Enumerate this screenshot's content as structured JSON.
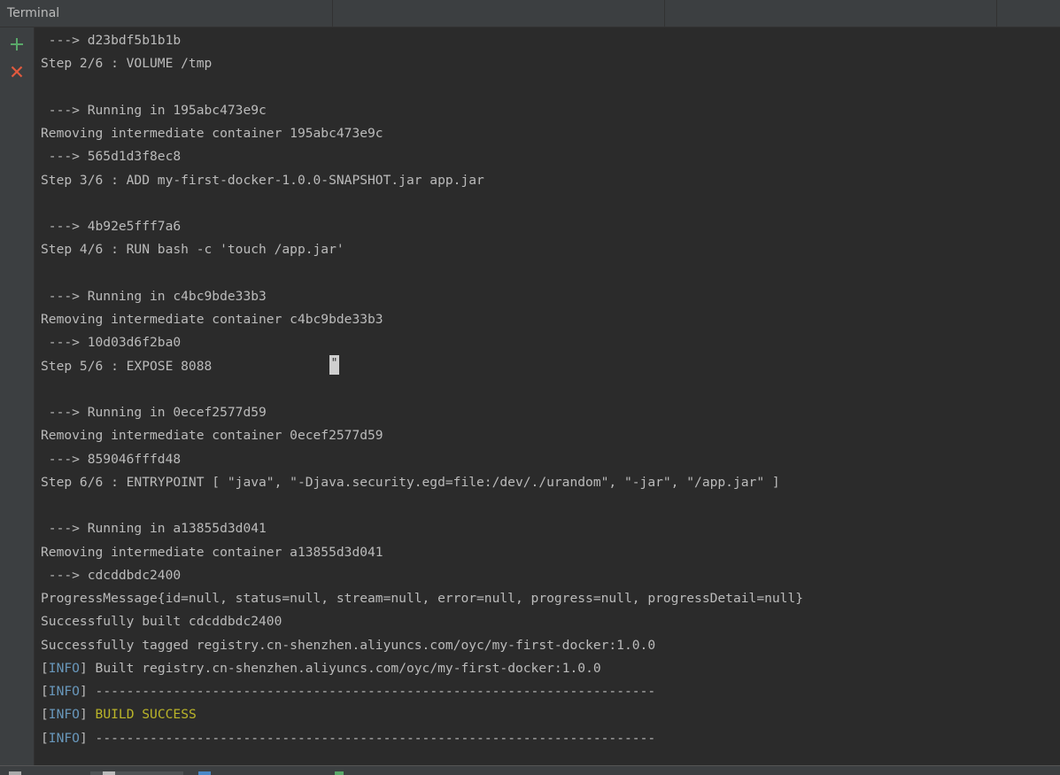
{
  "window": {
    "title": "Terminal"
  },
  "toolbar": {
    "new_icon": "plus-icon",
    "close_icon": "close-icon",
    "new_color": "#59a869",
    "close_color": "#e05a3e"
  },
  "colors": {
    "background": "#2b2b2b",
    "text": "#bbbbbb",
    "info_tag": "#6897bb",
    "success": "#bbb529"
  },
  "console": {
    "cursor_glyph": "\"",
    "lines": [
      {
        "text": " ---> d23bdf5b1b1b"
      },
      {
        "text": "Step 2/6 : VOLUME /tmp"
      },
      {
        "text": ""
      },
      {
        "text": " ---> Running in 195abc473e9c"
      },
      {
        "text": "Removing intermediate container 195abc473e9c"
      },
      {
        "text": " ---> 565d1d3f8ec8"
      },
      {
        "text": "Step 3/6 : ADD my-first-docker-1.0.0-SNAPSHOT.jar app.jar"
      },
      {
        "text": ""
      },
      {
        "text": " ---> 4b92e5fff7a6"
      },
      {
        "text": "Step 4/6 : RUN bash -c 'touch /app.jar'"
      },
      {
        "text": ""
      },
      {
        "text": " ---> Running in c4bc9bde33b3"
      },
      {
        "text": "Removing intermediate container c4bc9bde33b3"
      },
      {
        "text": " ---> 10d03d6f2ba0"
      },
      {
        "text": "Step 5/6 : EXPOSE 8088"
      },
      {
        "text": ""
      },
      {
        "text": " ---> Running in 0ecef2577d59"
      },
      {
        "text": "Removing intermediate container 0ecef2577d59"
      },
      {
        "text": " ---> 859046fffd48"
      },
      {
        "text": "Step 6/6 : ENTRYPOINT [ \"java\", \"-Djava.security.egd=file:/dev/./urandom\", \"-jar\", \"/app.jar\" ]"
      },
      {
        "text": ""
      },
      {
        "text": " ---> Running in a13855d3d041"
      },
      {
        "text": "Removing intermediate container a13855d3d041"
      },
      {
        "text": " ---> cdcddbdc2400"
      },
      {
        "text": "ProgressMessage{id=null, status=null, stream=null, error=null, progress=null, progressDetail=null}"
      },
      {
        "text": "Successfully built cdcddbdc2400"
      },
      {
        "text": "Successfully tagged registry.cn-shenzhen.aliyuncs.com/oyc/my-first-docker:1.0.0"
      },
      {
        "tag": "INFO",
        "text": " Built registry.cn-shenzhen.aliyuncs.com/oyc/my-first-docker:1.0.0"
      },
      {
        "tag": "INFO",
        "text": " ------------------------------------------------------------------------"
      },
      {
        "tag": "INFO",
        "text": " ",
        "success": "BUILD SUCCESS"
      },
      {
        "tag": "INFO",
        "text": " ------------------------------------------------------------------------"
      }
    ]
  }
}
